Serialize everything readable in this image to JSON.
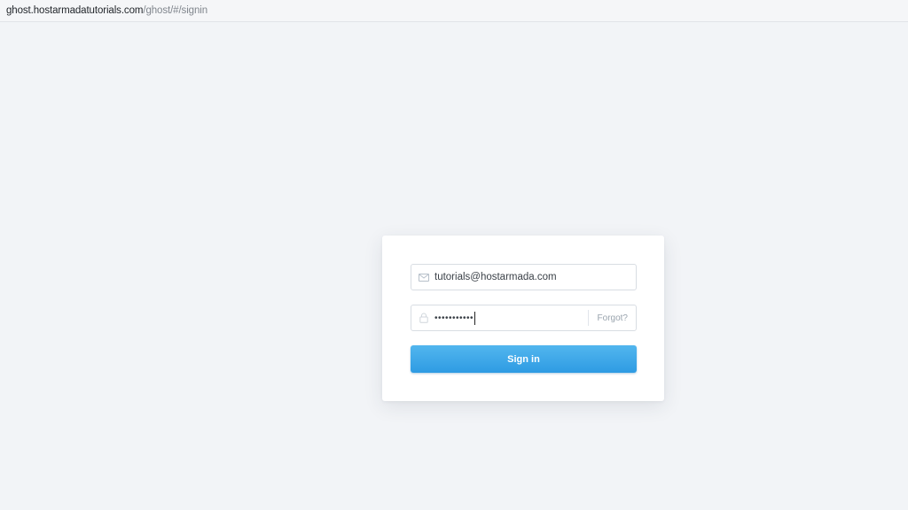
{
  "address_bar": {
    "host": "ghost.hostarmadatutorials.com",
    "path": "/ghost/#/signin"
  },
  "signin_form": {
    "email_icon": "envelope-icon",
    "email_value": "tutorials@hostarmada.com",
    "password_icon": "lock-icon",
    "password_value": "•••••••••••",
    "forgot_label": "Forgot?",
    "submit_label": "Sign in"
  },
  "colors": {
    "background": "#f2f4f7",
    "button_top": "#52b6ee",
    "button_bottom": "#2e9be3"
  }
}
